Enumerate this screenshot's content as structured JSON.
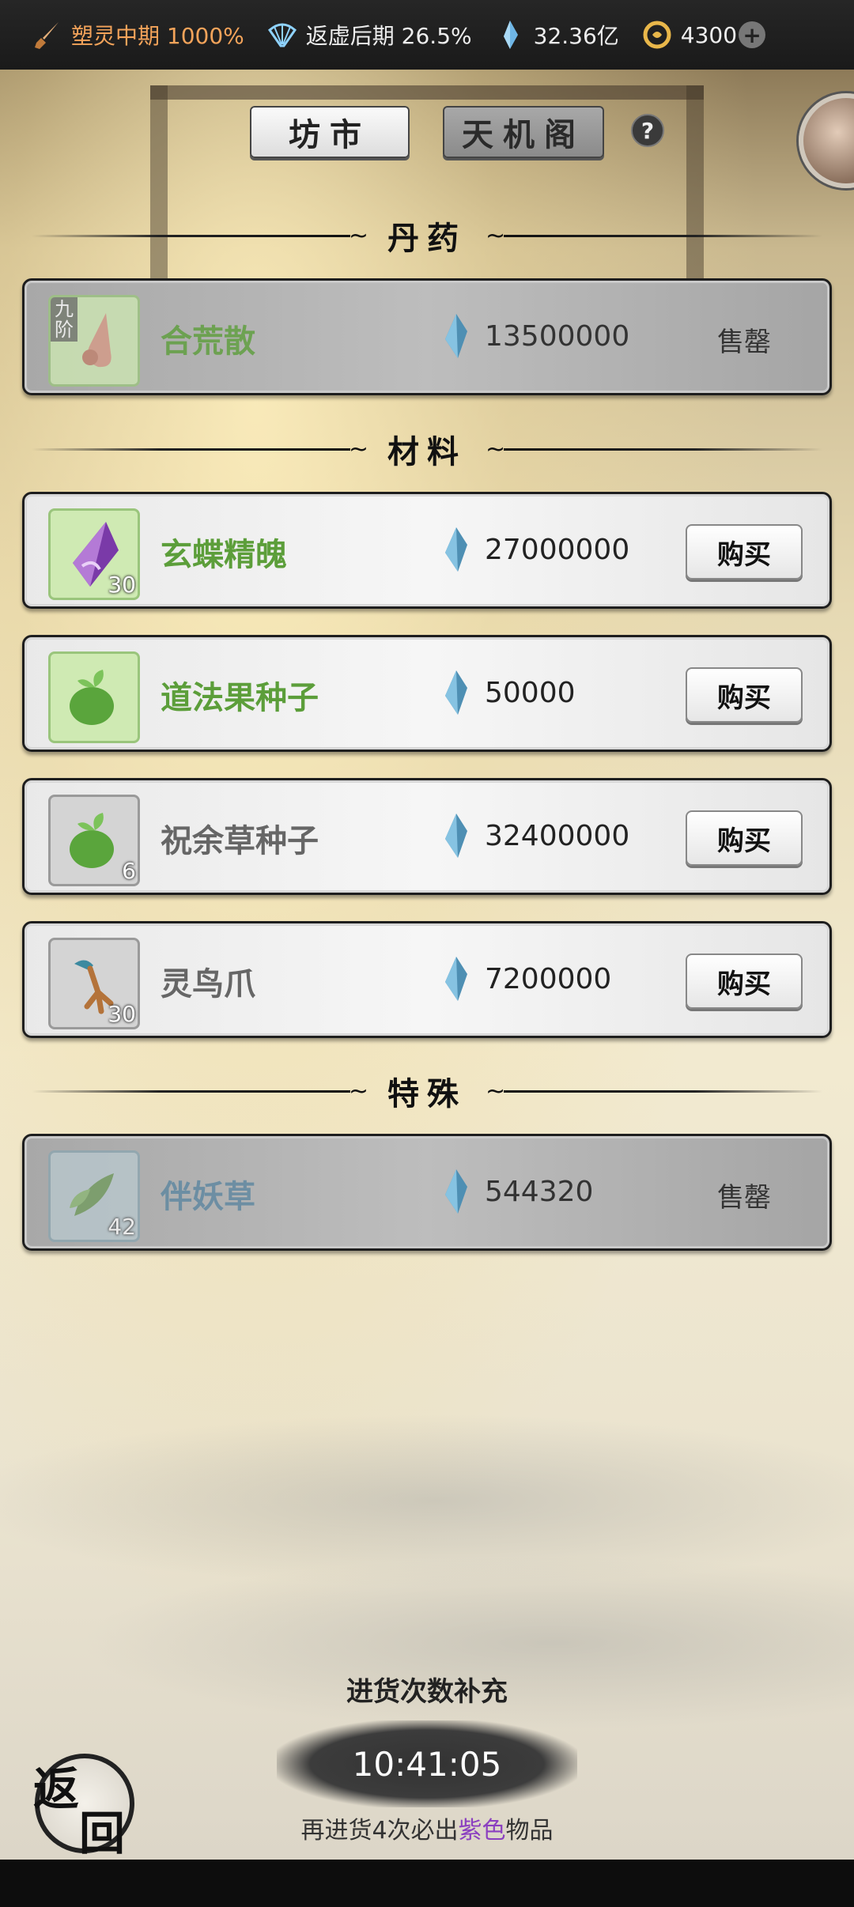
{
  "status_bar": {
    "realm": "塑灵中期 1000%",
    "secondary_realm": "返虚后期 26.5%",
    "spirit_stones": "32.36亿",
    "currency": "4300"
  },
  "tabs": [
    {
      "label": "坊市",
      "active": true
    },
    {
      "label": "天机阁",
      "active": false
    }
  ],
  "help_label": "?",
  "sections": {
    "pills": {
      "title": "丹药",
      "items": [
        {
          "name": "合荒散",
          "tier": "九阶",
          "price": "13500000",
          "status": "售罄"
        }
      ]
    },
    "materials": {
      "title": "材料",
      "items": [
        {
          "name": "玄蝶精魄",
          "count": "30",
          "price": "27000000",
          "action": "购买"
        },
        {
          "name": "道法果种子",
          "count": "",
          "price": "50000",
          "action": "购买"
        },
        {
          "name": "祝余草种子",
          "count": "6",
          "price": "32400000",
          "action": "购买"
        },
        {
          "name": "灵鸟爪",
          "count": "30",
          "price": "7200000",
          "action": "购买"
        }
      ]
    },
    "special": {
      "title": "特殊",
      "items": [
        {
          "name": "伴妖草",
          "count": "42",
          "price": "544320",
          "status": "售罄"
        }
      ]
    }
  },
  "restock": {
    "title": "进货次数补充",
    "timer": "10:41:05",
    "note_prefix": "再进货4次必出",
    "note_highlight": "紫色",
    "note_suffix": "物品"
  },
  "back_button": {
    "char1": "返",
    "char2": "回"
  },
  "colors": {
    "rarity_green": "#5c9e3a",
    "rarity_gray": "#666666",
    "rarity_blue": "#5c86a0",
    "highlight_purple": "#8b3fc0",
    "realm_orange": "#f3a35a"
  },
  "icons": [
    "sword-icon",
    "fan-icon",
    "spirit-stone-icon",
    "coin-icon",
    "plus-icon",
    "help-icon",
    "gem-icon"
  ]
}
